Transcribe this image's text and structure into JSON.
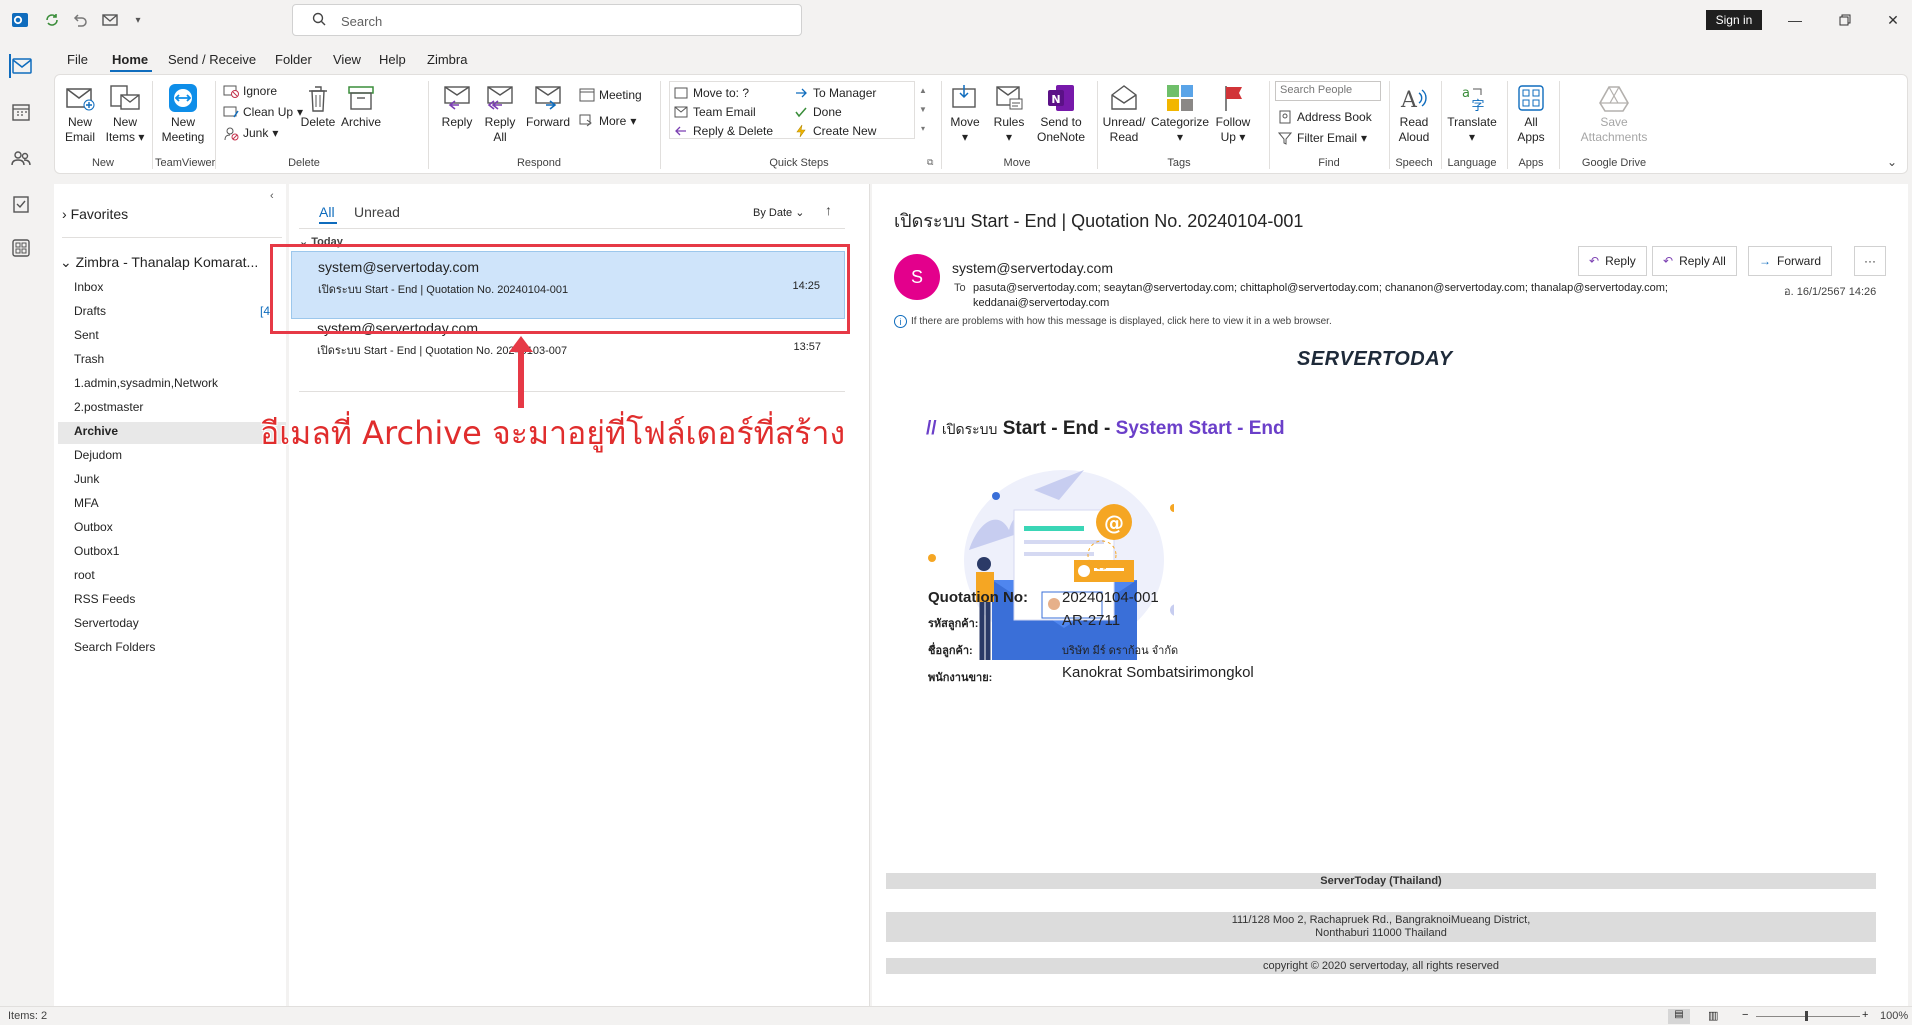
{
  "titlebar": {
    "search_placeholder": "Search",
    "sign_in": "Sign in"
  },
  "menu": {
    "tabs": [
      "File",
      "Home",
      "Send / Receive",
      "Folder",
      "View",
      "Help",
      "Zimbra"
    ],
    "active": "Home"
  },
  "ribbon": {
    "new_email": "New Email",
    "new_items": "New Items",
    "new_meeting": "New Meeting",
    "ignore": "Ignore",
    "clean_up": "Clean Up",
    "junk": "Junk",
    "delete": "Delete",
    "archive": "Archive",
    "reply": "Reply",
    "reply_all": "Reply All",
    "forward": "Forward",
    "meeting": "Meeting",
    "more": "More",
    "qs_move_to": "Move to: ?",
    "qs_team_email": "Team Email",
    "qs_reply_delete": "Reply & Delete",
    "qs_to_manager": "To Manager",
    "qs_done": "Done",
    "qs_create_new": "Create New",
    "move": "Move",
    "rules": "Rules",
    "send_to_onenote": "Send to OneNote",
    "unread_read": "Unread/ Read",
    "categorize": "Categorize",
    "follow_up": "Follow Up",
    "search_people_placeholder": "Search People",
    "address_book": "Address Book",
    "filter_email": "Filter Email",
    "read_aloud": "Read Aloud",
    "translate": "Translate",
    "all_apps": "All Apps",
    "save_attachments": "Save Attachments",
    "groups": {
      "new": "New",
      "teamviewer": "TeamViewer",
      "delete": "Delete",
      "respond": "Respond",
      "quick_steps": "Quick Steps",
      "move": "Move",
      "tags": "Tags",
      "find": "Find",
      "speech": "Speech",
      "language": "Language",
      "apps": "Apps",
      "google_drive": "Google Drive"
    }
  },
  "folders": {
    "favorites": "Favorites",
    "account": "Zimbra - Thanalap Komarat...",
    "items": [
      {
        "name": "Inbox",
        "count": ""
      },
      {
        "name": "Drafts",
        "count": "[4"
      },
      {
        "name": "Sent",
        "count": ""
      },
      {
        "name": "Trash",
        "count": ""
      },
      {
        "name": "1.admin,sysadmin,Network",
        "count": ""
      },
      {
        "name": "2.postmaster",
        "count": ""
      },
      {
        "name": "Archive",
        "count": ""
      },
      {
        "name": "Dejudom",
        "count": ""
      },
      {
        "name": "Junk",
        "count": ""
      },
      {
        "name": "MFA",
        "count": ""
      },
      {
        "name": "Outbox",
        "count": ""
      },
      {
        "name": "Outbox1",
        "count": ""
      },
      {
        "name": "root",
        "count": ""
      },
      {
        "name": "RSS Feeds",
        "count": ""
      },
      {
        "name": "Servertoday",
        "count": ""
      },
      {
        "name": "Search Folders",
        "count": ""
      }
    ]
  },
  "msglist": {
    "tab_all": "All",
    "tab_unread": "Unread",
    "sort": "By Date",
    "group_today": "Today",
    "messages": [
      {
        "from": "system@servertoday.com",
        "subject": "เปิดระบบ Start - End | Quotation No. 20240104-001",
        "time": "14:25"
      },
      {
        "from": "system@servertoday.com",
        "subject": "เปิดระบบ Start - End | Quotation No. 20240103-007",
        "time": "13:57"
      }
    ]
  },
  "annotation": "อีเมลที่ Archive จะมาอยู่ที่โฟล์เดอร์ที่สร้าง",
  "reading": {
    "subject": "เปิดระบบ Start - End | Quotation No. 20240104-001",
    "avatar_letter": "S",
    "from": "system@servertoday.com",
    "to_label": "To",
    "to_line1": "pasuta@servertoday.com; seaytan@servertoday.com; chittaphol@servertoday.com; chananon@servertoday.com; thanalap@servertoday.com;",
    "to_line2": "keddanai@servertoday.com",
    "date": "อ. 16/1/2567 14:26",
    "btn_reply": "Reply",
    "btn_reply_all": "Reply All",
    "btn_forward": "Forward",
    "info_bar": "If there are problems with how this message is displayed, click here to view it in a web browser.",
    "logo": "SERVERTODAY",
    "headline_prefix": "//",
    "headline_th": "เปิดระบบ",
    "headline_main": "Start - End -",
    "headline_accent": "System Start - End",
    "quotation_label": "Quotation No:",
    "quotation_value": "20240104-001",
    "customer_code_label": "รหัสลูกค้า:",
    "customer_code_value": "AR-2711",
    "customer_name_label": "ชื่อลูกค้า:",
    "customer_name_value": "บริษัท มีร์ ดราก้อน จำกัด",
    "sales_label": "พนักงานขาย:",
    "sales_value": "Kanokrat Sombatsirimongkol",
    "footer_company": "ServerToday (Thailand)",
    "footer_addr1": "111/128 Moo 2, Rachapruek Rd., BangraknoiMueang District,",
    "footer_addr2": "Nonthaburi 11000 Thailand",
    "footer_copyright": "copyright © 2020 servertoday, all rights reserved"
  },
  "status": {
    "items": "Items: 2",
    "zoom": "100%"
  },
  "colors": {
    "accent": "#0f6cbd",
    "annotation": "#e63946",
    "avatar": "#e3008c",
    "headline_accent": "#6b3fc9"
  }
}
